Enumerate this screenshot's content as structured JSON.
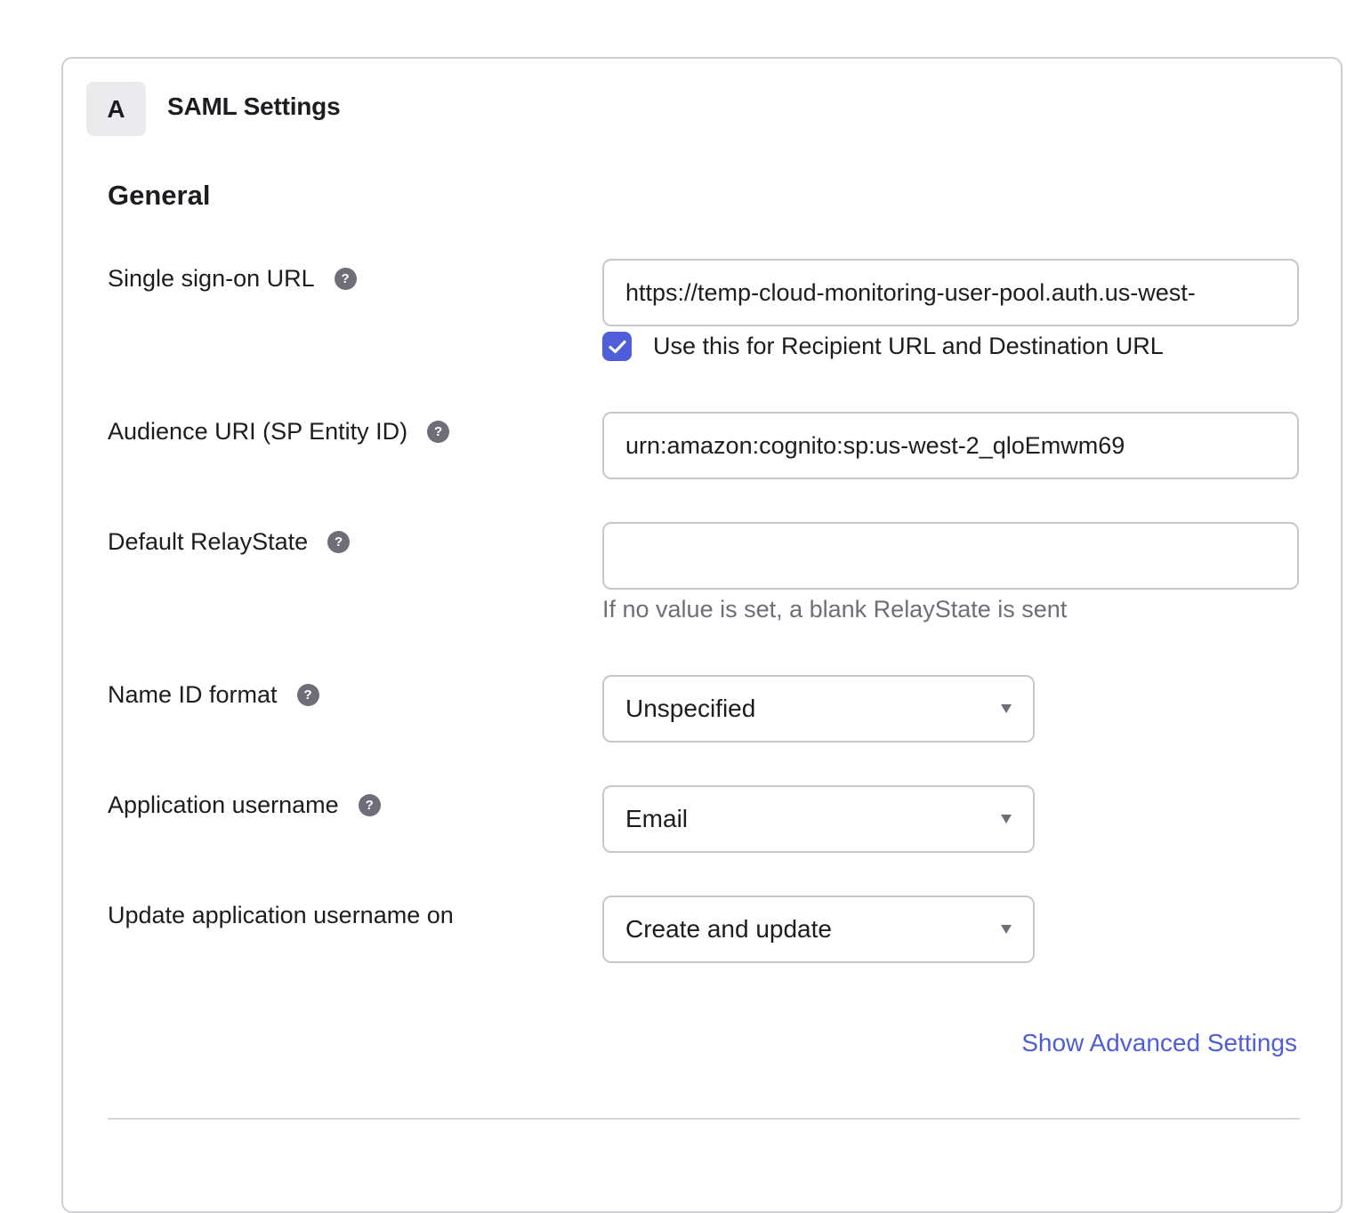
{
  "card": {
    "step_badge": "A",
    "title": "SAML Settings"
  },
  "section": {
    "title": "General"
  },
  "fields": {
    "sso_url": {
      "label": "Single sign-on URL",
      "help_icon": "question-circle-icon",
      "value": "https://temp-cloud-monitoring-user-pool.auth.us-west-",
      "checkbox": {
        "checked": true,
        "label": "Use this for Recipient URL and Destination URL"
      }
    },
    "audience_uri": {
      "label": "Audience URI (SP Entity ID)",
      "help_icon": "question-circle-icon",
      "value": "urn:amazon:cognito:sp:us-west-2_qloEmwm69"
    },
    "relay_state": {
      "label": "Default RelayState",
      "help_icon": "question-circle-icon",
      "value": "",
      "hint": "If no value is set, a blank RelayState is sent"
    },
    "name_id_format": {
      "label": "Name ID format",
      "help_icon": "question-circle-icon",
      "selected": "Unspecified"
    },
    "app_username": {
      "label": "Application username",
      "help_icon": "question-circle-icon",
      "selected": "Email"
    },
    "update_username_on": {
      "label": "Update application username on",
      "selected": "Create and update"
    }
  },
  "links": {
    "advanced": "Show Advanced Settings"
  },
  "colors": {
    "accent": "#4f5ed8",
    "help_icon": "#6e6e78",
    "border": "#c8c8cc",
    "hint_text": "#6e6e78"
  }
}
